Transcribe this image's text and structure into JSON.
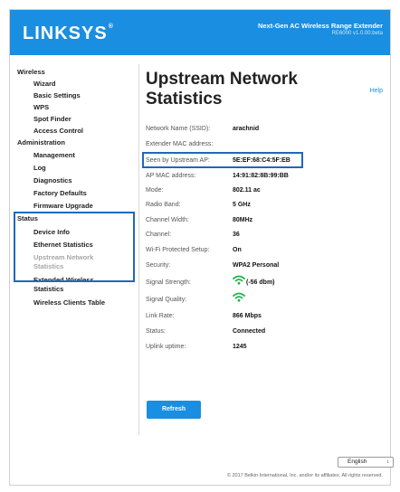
{
  "header": {
    "logo": "LINKSYS",
    "logo_tm": "®",
    "product_name": "Next-Gen AC Wireless Range Extender",
    "version": "RE6000 v1.0.00.beta"
  },
  "sidebar": {
    "groups": [
      {
        "label": "Wireless",
        "items": [
          "Wizard",
          "Basic Settings",
          "WPS",
          "Spot Finder",
          "Access Control"
        ]
      },
      {
        "label": "Administration",
        "items": [
          "Management",
          "Log",
          "Diagnostics",
          "Factory Defaults",
          "Firmware Upgrade"
        ]
      },
      {
        "label": "Status",
        "items": [
          "Device Info",
          "Ethernet Statistics",
          "Upstream Network Statistics",
          "Extended Wireless Statistics",
          "Wireless Clients Table"
        ]
      }
    ]
  },
  "page": {
    "title_line1": "Upstream Network",
    "title_line2": "Statistics",
    "help": "Help"
  },
  "stats": [
    {
      "label": "Network Name (SSID):",
      "value": "arachnid"
    },
    {
      "label": "Extender MAC address:",
      "value": ""
    },
    {
      "label": "Seen by Upstream AP:",
      "value": "5E:EF:68:C4:5F:EB"
    },
    {
      "label": "AP MAC address:",
      "value": "14:91:82:8B:99:BB"
    },
    {
      "label": "Mode:",
      "value": "802.11 ac"
    },
    {
      "label": "Radio Band:",
      "value": "5 GHz"
    },
    {
      "label": "Channel Width:",
      "value": "80MHz"
    },
    {
      "label": "Channel:",
      "value": "36"
    },
    {
      "label": "Wi-Fi Protected Setup:",
      "value": "On"
    },
    {
      "label": "Security:",
      "value": "WPA2 Personal"
    },
    {
      "label": "Signal Strength:",
      "value": "(-56 dbm)"
    },
    {
      "label": "Signal Quality:",
      "value": ""
    },
    {
      "label": "Link Rate:",
      "value": "866 Mbps"
    },
    {
      "label": "Status:",
      "value": "Connected"
    },
    {
      "label": "Uplink uptime:",
      "value": "1245"
    }
  ],
  "colors": {
    "brand_blue": "#1a8ee0",
    "highlight_box": "#1e68bf",
    "wifi_green": "#21b24b"
  },
  "icons": {
    "signal_strength": "wifi-icon",
    "signal_quality": "wifi-icon"
  },
  "actions": {
    "refresh": "Refresh"
  },
  "footer": {
    "language": "English",
    "copyright": "© 2017 Belkin International, Inc. and/or its affiliates. All rights reserved."
  }
}
